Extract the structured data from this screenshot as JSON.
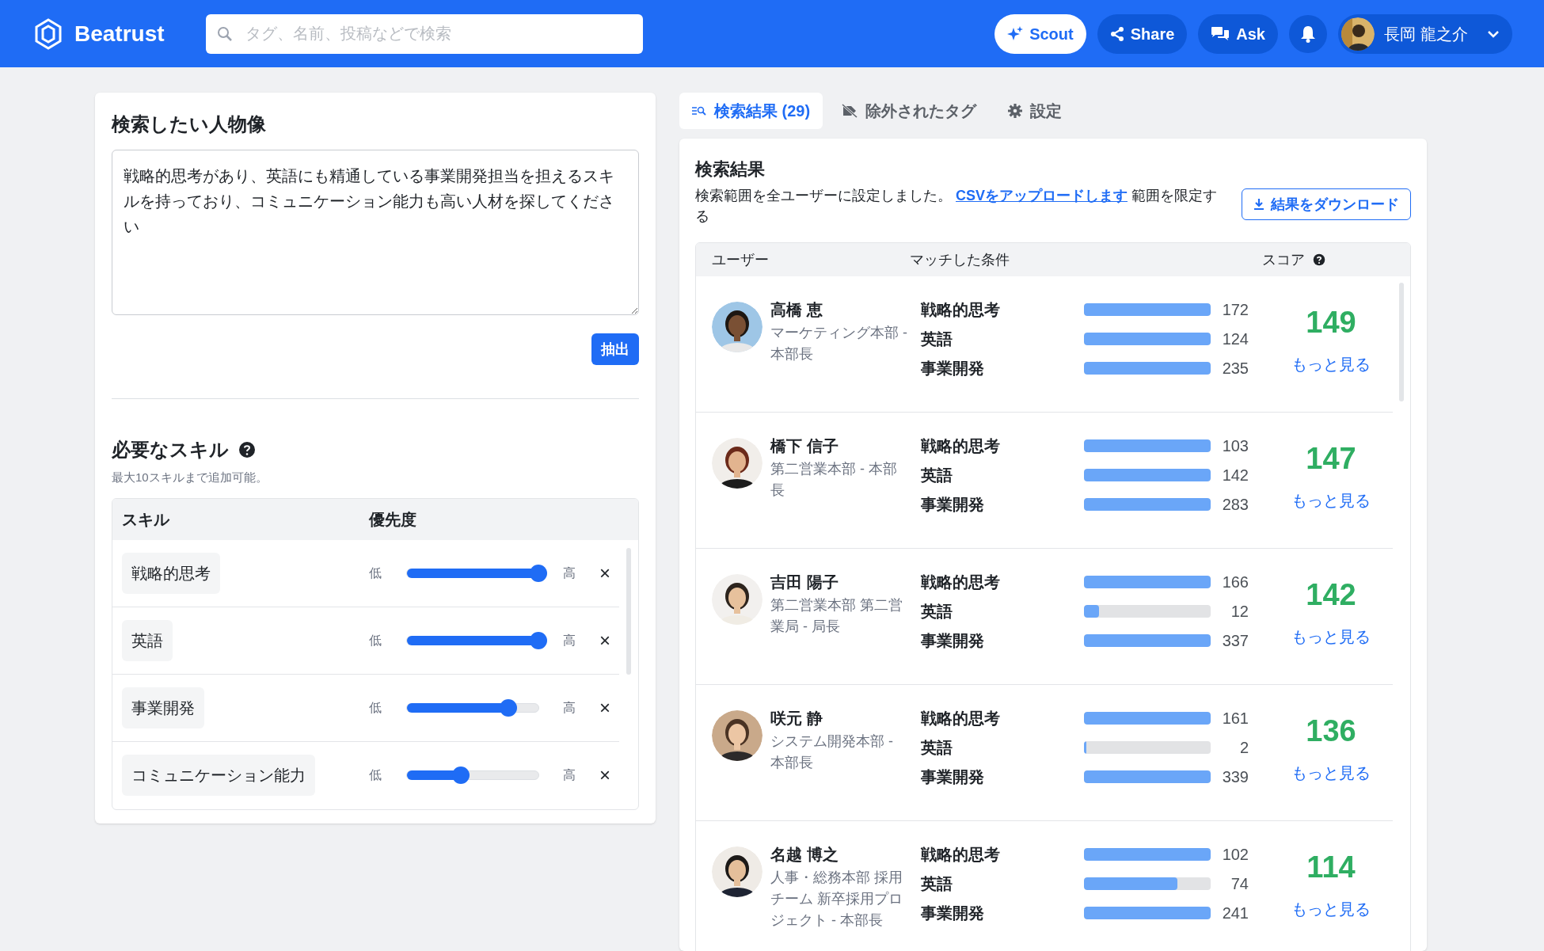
{
  "header": {
    "brand": "Beatrust",
    "search": {
      "placeholder": "タグ、名前、投稿などで検索"
    },
    "buttons": [
      {
        "label": "Scout",
        "kind": "scout"
      },
      {
        "label": "Share",
        "kind": "share"
      },
      {
        "label": "Ask",
        "kind": "ask"
      }
    ],
    "user": {
      "name": "長岡 龍之介"
    }
  },
  "persona": {
    "title": "検索したい人物像",
    "text": "戦略的思考があり、英語にも精通している事業開発担当を担えるスキルを持っており、コミュニケーション能力も高い人材を探してください",
    "button": "抽出"
  },
  "skills": {
    "title": "必要なスキル",
    "note": "最大10スキルまで追加可能。",
    "columns": [
      "スキル",
      "優先度"
    ],
    "rows": [
      {
        "name": "戦略的思考",
        "low": "低",
        "high": "高",
        "level": 1.0,
        "remove": "×"
      },
      {
        "name": "英語",
        "low": "低",
        "high": "高",
        "level": 1.0,
        "remove": "×"
      },
      {
        "name": "事業開発",
        "low": "低",
        "high": "高",
        "level": 0.77,
        "remove": "×"
      },
      {
        "name": "コミュニケーション能力",
        "low": "低",
        "high": "高",
        "level": 0.41,
        "remove": "×"
      }
    ]
  },
  "tabs": [
    {
      "label": "検索結果 (29)",
      "kind": "results",
      "selected": true
    },
    {
      "label": "除外されたタグ",
      "kind": "tags",
      "selected": false
    },
    {
      "label": "設定",
      "kind": "settings",
      "selected": false
    }
  ],
  "results": {
    "title": "検索結果",
    "notice_before": "検索範囲を全ユーザーに設定しました。",
    "notice_link": "CSVをアップロードします",
    "notice_after": "範囲を限定する",
    "download": "結果をダウンロード",
    "columns": [
      "ユーザー",
      "マッチした条件",
      "スコア"
    ],
    "rows": [
      {
        "name": "高橋 恵",
        "dept": "マーケティング本部 - 本部長",
        "score": "149",
        "more": "もっと見る",
        "matches": [
          {
            "label": "戦略的思考",
            "value": "172",
            "level": 1.0
          },
          {
            "label": "英語",
            "value": "124",
            "level": 1.0
          },
          {
            "label": "事業開発",
            "value": "235",
            "level": 1.0
          }
        ]
      },
      {
        "name": "橋下 信子",
        "dept": "第二営業本部 - 本部長",
        "score": "147",
        "more": "もっと見る",
        "matches": [
          {
            "label": "戦略的思考",
            "value": "103",
            "level": 1.0
          },
          {
            "label": "英語",
            "value": "142",
            "level": 1.0
          },
          {
            "label": "事業開発",
            "value": "283",
            "level": 1.0
          }
        ]
      },
      {
        "name": "吉田 陽子",
        "dept": "第二営業本部 第二営業局 - 局長",
        "score": "142",
        "more": "もっと見る",
        "matches": [
          {
            "label": "戦略的思考",
            "value": "166",
            "level": 1.0
          },
          {
            "label": "英語",
            "value": "12",
            "level": 0.12
          },
          {
            "label": "事業開発",
            "value": "337",
            "level": 1.0
          }
        ]
      },
      {
        "name": "咲元 静",
        "dept": "システム開発本部 - 本部長",
        "score": "136",
        "more": "もっと見る",
        "matches": [
          {
            "label": "戦略的思考",
            "value": "161",
            "level": 1.0
          },
          {
            "label": "英語",
            "value": "2",
            "level": 0.02
          },
          {
            "label": "事業開発",
            "value": "339",
            "level": 1.0
          }
        ]
      },
      {
        "name": "名越 博之",
        "dept": "人事・総務本部 採用チーム 新卒採用プロジェクト - 本部長",
        "score": "114",
        "more": "もっと見る",
        "matches": [
          {
            "label": "戦略的思考",
            "value": "102",
            "level": 1.0
          },
          {
            "label": "英語",
            "value": "74",
            "level": 0.74
          },
          {
            "label": "事業開発",
            "value": "241",
            "level": 1.0
          }
        ]
      }
    ]
  }
}
